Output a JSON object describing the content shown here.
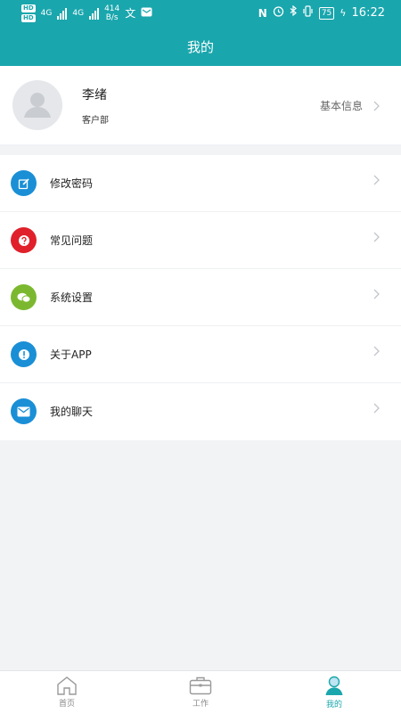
{
  "status_bar": {
    "hd1": "HD",
    "hd2": "HD",
    "net1": "4G",
    "net2": "4G",
    "speed_value": "414",
    "speed_unit": "B/s",
    "battery": "75",
    "time": "16:22"
  },
  "header": {
    "title": "我的"
  },
  "profile": {
    "name": "李绪",
    "department": "客户部",
    "info_link": "基本信息"
  },
  "menu": [
    {
      "label": "修改密码",
      "icon": "edit-icon",
      "color": "#1a8fd6"
    },
    {
      "label": "常见问题",
      "icon": "question-icon",
      "color": "#e0202a"
    },
    {
      "label": "系统设置",
      "icon": "chat-bubbles-icon",
      "color": "#7cb82f"
    },
    {
      "label": "关于APP",
      "icon": "info-icon",
      "color": "#1a8fd6"
    },
    {
      "label": "我的聊天",
      "icon": "mail-icon",
      "color": "#1a8fd6"
    }
  ],
  "bottom_nav": [
    {
      "label": "首页",
      "icon": "home-icon",
      "active": false
    },
    {
      "label": "工作",
      "icon": "briefcase-icon",
      "active": false
    },
    {
      "label": "我的",
      "icon": "person-icon",
      "active": true
    }
  ],
  "colors": {
    "accent": "#1aa6ad",
    "background": "#f2f3f5"
  }
}
